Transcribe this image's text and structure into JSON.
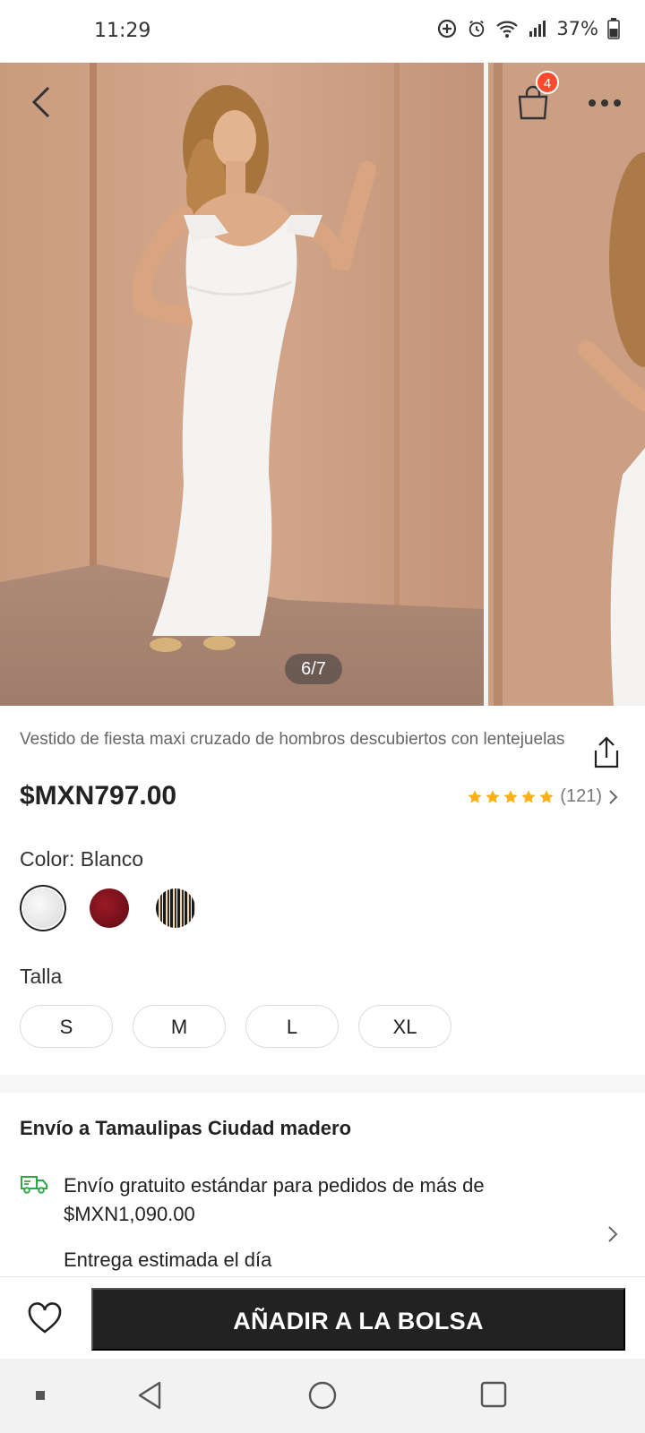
{
  "status_bar": {
    "time": "11:29",
    "battery": "37%"
  },
  "gallery": {
    "cart_count": "4",
    "image_counter": "6/7"
  },
  "product": {
    "title": "Vestido de fiesta maxi cruzado de hombros descubiertos con lentejuelas",
    "price": "$MXN797.00",
    "rating_stars": 5,
    "review_count": "(121)",
    "color_label": "Color: Blanco",
    "colors": [
      "Blanco",
      "Burdeos",
      "Lentejuelas"
    ],
    "size_label": "Talla",
    "sizes": [
      "S",
      "M",
      "L",
      "XL"
    ]
  },
  "shipping": {
    "title": "Envío a Tamaulipas Ciudad madero",
    "free_shipping": "Envío gratuito estándar para pedidos de más de $MXN1,090.00",
    "delivery": "Entrega estimada el día"
  },
  "actions": {
    "add_to_bag": "AÑADIR A LA BOLSA"
  },
  "colors": {
    "accent": "#fa4b2f",
    "star": "#fbb117",
    "button_bg": "#222222",
    "truck": "#2ea84b"
  },
  "icons": [
    "back-icon",
    "shopping-bag-icon",
    "more-icon",
    "share-icon",
    "star-icon",
    "chevron-right-icon",
    "truck-icon",
    "heart-icon",
    "nav-back-icon",
    "nav-home-icon",
    "nav-recents-icon"
  ]
}
